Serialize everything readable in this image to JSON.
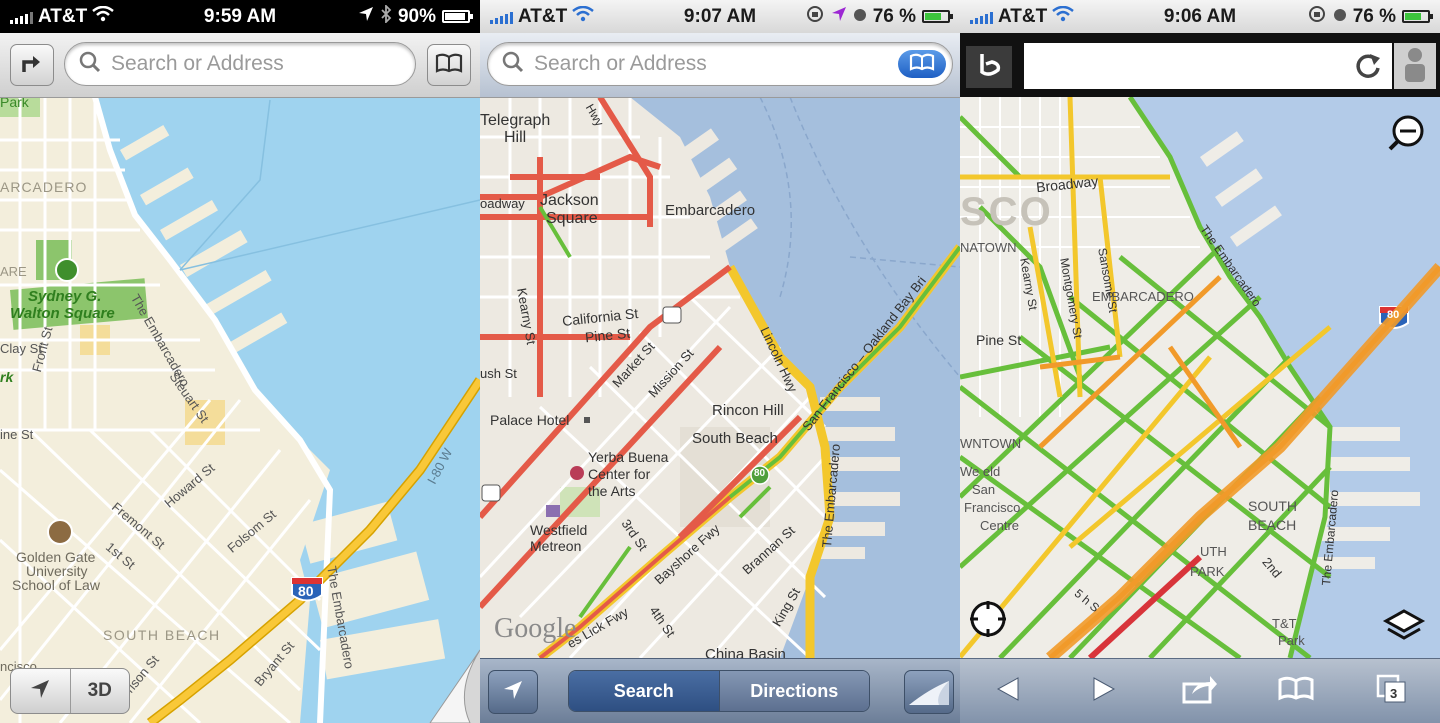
{
  "panels": [
    {
      "id": "apple-maps",
      "status": {
        "carrier": "AT&T",
        "time": "9:59 AM",
        "battery": "90%"
      },
      "search": {
        "placeholder": "Search or Address"
      },
      "labels": {
        "park": "Park",
        "embarcadero_area": "ARCADERO",
        "square1": "Sydney G.",
        "square2": "Walton Square",
        "clay": "Clay St",
        "front": "Front St",
        "the_embarcadero1": "The Embarcadero",
        "steuart": "Steuart St",
        "pine": "ine St",
        "howard": "Howard St",
        "fremont": "Fremont St",
        "folsom": "Folsom St",
        "first": "1st St",
        "ggu1": "Golden Gate",
        "ggu2": "University",
        "ggu3": "School of Law",
        "south_beach": "SOUTH BEACH",
        "bryant": "Bryant St",
        "the_embarcadero2": "The Embarcadero",
        "i80w": "I-80 W",
        "shield": "80",
        "harrison": "rrison St",
        "rk": "rk",
        "left_frag": "y",
        "are": "ARE",
        "ncisco": "ncisco"
      },
      "buttons": {
        "three_d": "3D"
      }
    },
    {
      "id": "google-maps",
      "status": {
        "carrier": "AT&T",
        "time": "9:07 AM",
        "battery": "76 %"
      },
      "search": {
        "placeholder": "Search or Address"
      },
      "labels": {
        "telegraph1": "Telegraph",
        "telegraph2": "Hill",
        "jackson1": "Jackson",
        "jackson2": "Square",
        "embarcadero": "Embarcadero",
        "broadway": "oadway",
        "california": "California St",
        "pine": "Pine St",
        "kearny": "Kearny St",
        "market": "Market St",
        "mission": "Mission St",
        "bush": "ush St",
        "lincoln": "Lincoln Hwy",
        "bay_bridge": "San Francisco – Oakland Bay Bri",
        "rincon": "Rincon Hill",
        "south_beach": "South Beach",
        "palace": "Palace Hotel",
        "yerba1": "Yerba Buena",
        "yerba2": "Center for",
        "yerba3": "the Arts",
        "westfield1": "Westfield",
        "westfield2": "Metreon",
        "third": "3rd St",
        "fourth": "4th St",
        "bayshore": "Bayshore Fwy",
        "brannan": "Brannan St",
        "king": "King St",
        "the_embarcadero": "The Embarcadero",
        "china_basin": "China Basin",
        "hwy": "Hwy",
        "shield": "80",
        "google": "Google",
        "lick": "es Lick Fwy"
      },
      "bottom": {
        "search": "Search",
        "directions": "Directions"
      }
    },
    {
      "id": "bing-maps",
      "status": {
        "carrier": "AT&T",
        "time": "9:06 AM",
        "battery": "76 %"
      },
      "labels": {
        "sco": "SCO",
        "broadway": "Broadway",
        "natown": "NATOWN",
        "embarcadero": "EMBARCADERO",
        "the_embarcadero1": "The Embarcadero",
        "the_embarcadero2": "The Embarcadero",
        "pine": "Pine St",
        "kearny": "Kearny St",
        "montgomery": "Montgomery St",
        "sansome": "Sansome St",
        "ntown": "WNTOWN",
        "wefield": "We  eld",
        "san": "San",
        "francisco": "Francisco",
        "centre": "Centre",
        "south_beach1": "SOUTH",
        "south_beach2": "BEACH",
        "south_park1": "UTH",
        "south_park2": "PARK",
        "second": "2nd",
        "att1": "T&T",
        "att2": "Park",
        "fifth": "5  h S",
        "shield": "80"
      },
      "toolbar": {
        "tabs_count": "3"
      }
    }
  ],
  "colors": {
    "water_apple": "#9fd3ef",
    "land_apple": "#f3eedc",
    "water_google": "#a5bfdd",
    "land_google": "#ede9e1",
    "water_bing": "#b3cbe8",
    "land_bing": "#efede7",
    "traffic_red": "#e45a48",
    "traffic_yellow": "#f3c72c",
    "traffic_green": "#67bf3b",
    "traffic_orange": "#f19a2a"
  }
}
